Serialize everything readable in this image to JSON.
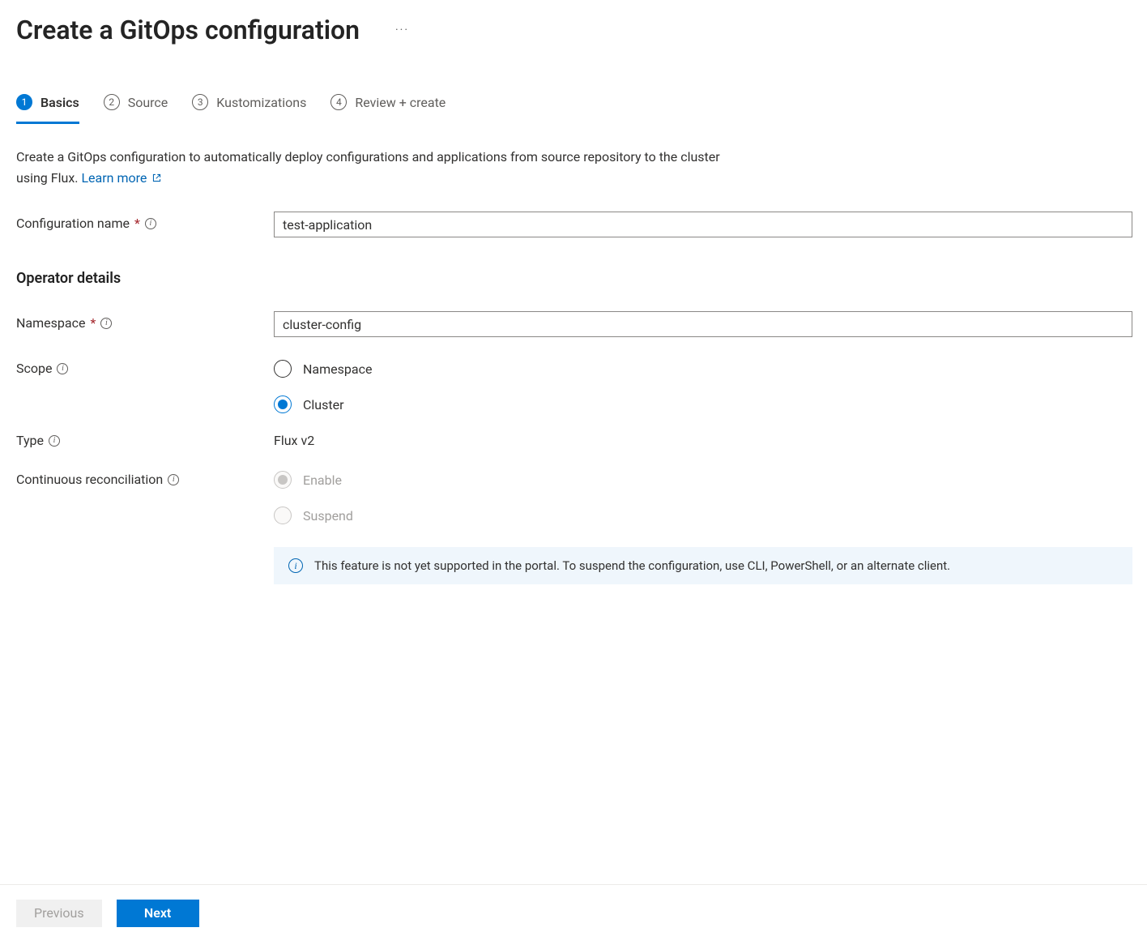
{
  "header": {
    "title": "Create a GitOps configuration"
  },
  "tabs": [
    {
      "num": "1",
      "label": "Basics"
    },
    {
      "num": "2",
      "label": "Source"
    },
    {
      "num": "3",
      "label": "Kustomizations"
    },
    {
      "num": "4",
      "label": "Review + create"
    }
  ],
  "description": {
    "text_a": "Create a GitOps configuration to automatically deploy configurations and applications from source repository to the cluster using Flux. ",
    "link": "Learn more"
  },
  "section": {
    "operator_details": "Operator details"
  },
  "labels": {
    "config_name": "Configuration name",
    "namespace": "Namespace",
    "scope": "Scope",
    "type": "Type",
    "continuous_reconciliation": "Continuous reconciliation"
  },
  "fields": {
    "config_name": "test-application",
    "namespace": "cluster-config",
    "scope_options": {
      "namespace": "Namespace",
      "cluster": "Cluster"
    },
    "type": "Flux v2",
    "reconciliation_options": {
      "enable": "Enable",
      "suspend": "Suspend"
    }
  },
  "info_box": {
    "text": "This feature is not yet supported in the portal. To suspend the configuration, use CLI, PowerShell, or an alternate client."
  },
  "footer": {
    "previous": "Previous",
    "next": "Next"
  }
}
